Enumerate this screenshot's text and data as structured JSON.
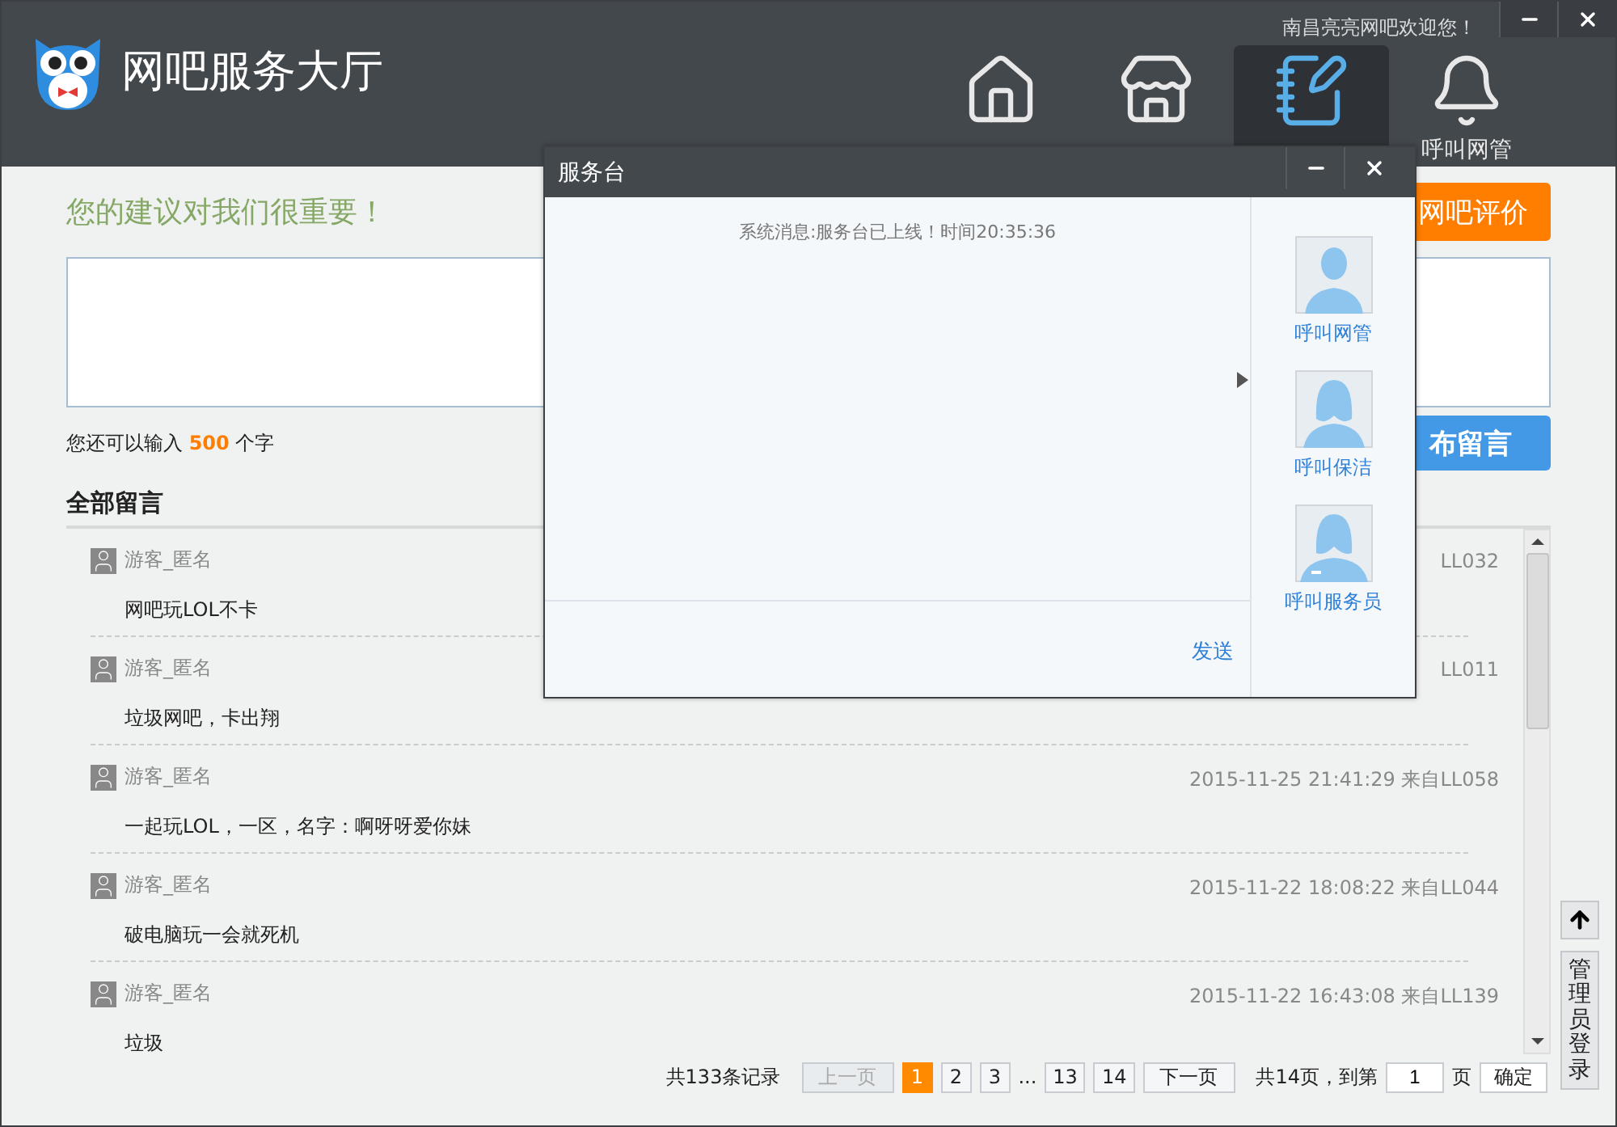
{
  "window": {
    "title": "网吧服务大厅",
    "welcome": "南昌亮亮网吧欢迎您！",
    "controls": [
      {
        "kind": "minimize"
      },
      {
        "kind": "close"
      }
    ]
  },
  "nav": [
    {
      "selected": false
    },
    {
      "selected": false
    },
    {
      "selected": true
    },
    {
      "label": "呼叫网管",
      "selected": false
    }
  ],
  "feedback": {
    "heading": "您的建议对我们很重要！",
    "review_button": "网吧评价",
    "counter_prefix": "您还可以输入",
    "counter_count": "500",
    "counter_suffix": "个字",
    "submit_button": "布留言"
  },
  "messages": {
    "title": "全部留言",
    "items": [
      {
        "author": "游客_匿名",
        "text": "网吧玩LOL不卡",
        "meta": "LL032"
      },
      {
        "author": "游客_匿名",
        "text": "垃圾网吧，卡出翔",
        "meta": "LL011"
      },
      {
        "author": "游客_匿名",
        "text": "一起玩LOL，一区，名字：啊呀呀爱你妹",
        "meta": "2015-11-25 21:41:29 来自LL058"
      },
      {
        "author": "游客_匿名",
        "text": "破电脑玩一会就死机",
        "meta": "2015-11-22 18:08:22 来自LL044"
      },
      {
        "author": "游客_匿名",
        "text": "垃圾",
        "meta": "2015-11-22 16:43:08 来自LL139"
      }
    ]
  },
  "pagination": {
    "total": "共133条记录",
    "prev": {
      "label": "上一页",
      "disabled": true
    },
    "pages": [
      {
        "kind": "page",
        "label": "1",
        "selected": true
      },
      {
        "kind": "page",
        "label": "2",
        "selected": false
      },
      {
        "kind": "page",
        "label": "3",
        "selected": false
      },
      {
        "kind": "ellipsis",
        "label": "..."
      },
      {
        "kind": "page",
        "label": "13",
        "selected": false
      },
      {
        "kind": "page",
        "label": "14",
        "selected": false
      }
    ],
    "next": {
      "label": "下一页",
      "disabled": false
    },
    "jump_prefix": "共14页，到第",
    "jump_value": "1",
    "jump_suffix": "页",
    "confirm": "确定"
  },
  "side": {
    "admin_login": "管理员登录"
  },
  "dialog": {
    "title": "服务台",
    "message": "系统消息:服务台已上线！时间20:35:36",
    "send": "发送",
    "contacts": [
      {
        "label": "呼叫网管"
      },
      {
        "label": "呼叫保洁"
      },
      {
        "label": "呼叫服务员"
      }
    ]
  }
}
